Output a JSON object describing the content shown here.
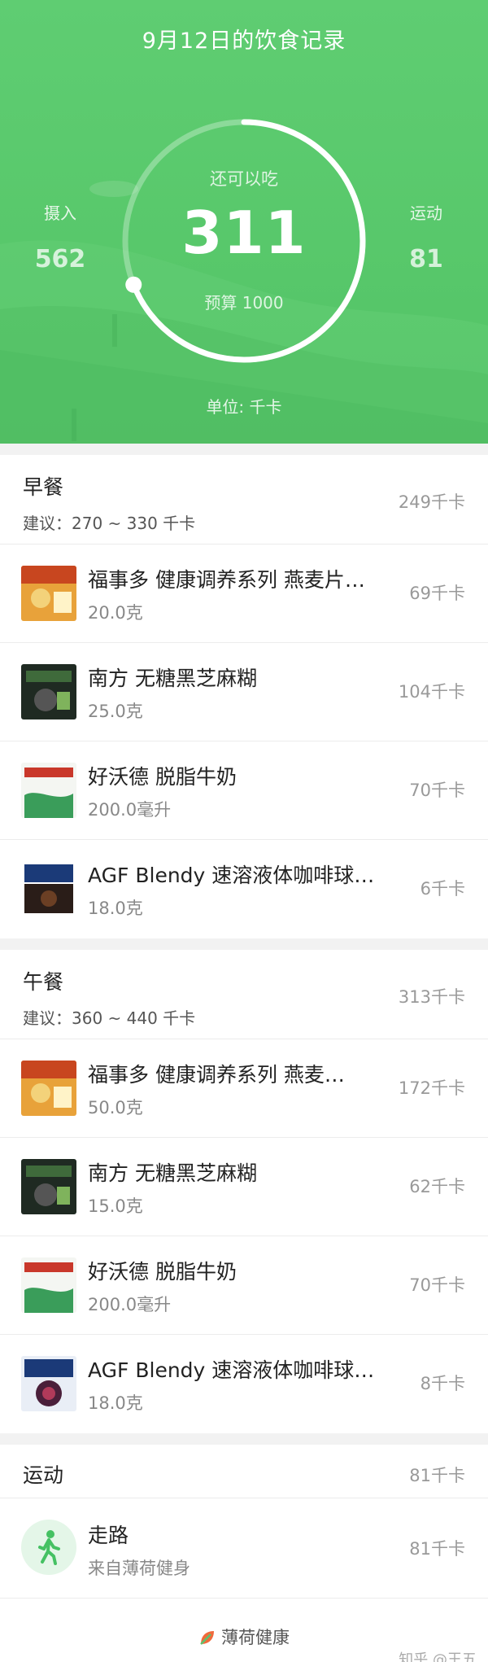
{
  "header": {
    "title": "9月12日的饮食记录",
    "remaining_label": "还可以吃",
    "remaining_value": "311",
    "budget": "预算 1000",
    "intake_label": "摄入",
    "intake_value": "562",
    "exercise_label": "运动",
    "exercise_value": "81",
    "unit": "单位: 千卡",
    "progress_fraction": 0.69,
    "accent_color": "#5fcd72"
  },
  "meals": [
    {
      "name": "早餐",
      "suggest": "建议：270 ~ 330 千卡",
      "total": "249千卡",
      "items": [
        {
          "name": "福事多 健康调养系列 燕麦片…",
          "amount": "20.0克",
          "kcal": "69千卡",
          "icon": "oatmeal-package-icon"
        },
        {
          "name": "南方 无糖黑芝麻糊",
          "amount": "25.0克",
          "kcal": "104千卡",
          "icon": "sesame-paste-package-icon"
        },
        {
          "name": "好沃德 脱脂牛奶",
          "amount": "200.0毫升",
          "kcal": "70千卡",
          "icon": "milk-carton-icon"
        },
        {
          "name": "AGF Blendy 速溶液体咖啡球…",
          "amount": "18.0克",
          "kcal": "6千卡",
          "icon": "coffee-package-icon"
        }
      ]
    },
    {
      "name": "午餐",
      "suggest": "建议：360 ~ 440 千卡",
      "total": "313千卡",
      "items": [
        {
          "name": "福事多 健康调养系列 燕麦…",
          "amount": "50.0克",
          "kcal": "172千卡",
          "icon": "oatmeal-package-icon"
        },
        {
          "name": "南方 无糖黑芝麻糊",
          "amount": "15.0克",
          "kcal": "62千卡",
          "icon": "sesame-paste-package-icon"
        },
        {
          "name": "好沃德 脱脂牛奶",
          "amount": "200.0毫升",
          "kcal": "70千卡",
          "icon": "milk-carton-icon"
        },
        {
          "name": "AGF Blendy 速溶液体咖啡球…",
          "amount": "18.0克",
          "kcal": "8千卡",
          "icon": "coffee-package-icon"
        }
      ]
    }
  ],
  "exercise": {
    "title": "运动",
    "total": "81千卡",
    "item_name": "走路",
    "item_source": "来自薄荷健身",
    "item_kcal": "81千卡",
    "icon": "walking-person-icon"
  },
  "footer": {
    "brand": "薄荷健康",
    "watermark": "知乎 @王五"
  }
}
